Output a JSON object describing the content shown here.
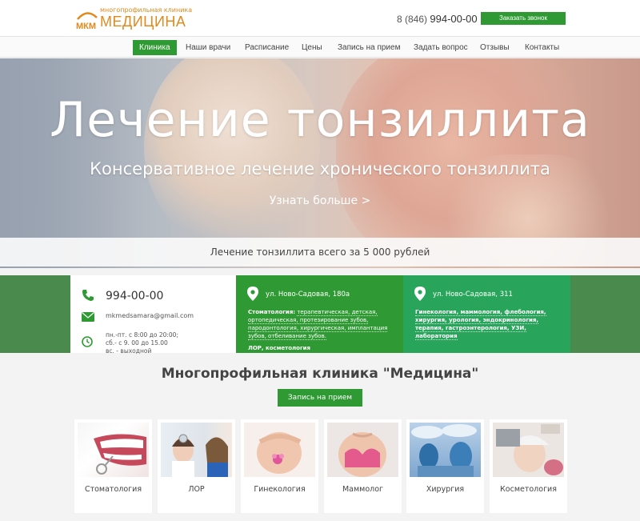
{
  "header": {
    "logo_small": "многопрофильная клиника",
    "logo_big": "МЕДИЦИНА",
    "logo_mark": "МКМ",
    "phone_prefix": "8 (846)",
    "phone_number": "994-00-00",
    "callback_label": "Заказать звонок",
    "accent_color": "#2f9a33",
    "logo_color": "#e08a1e"
  },
  "nav": {
    "items": [
      {
        "label": "Клиника",
        "active": true
      },
      {
        "label": "Наши врачи",
        "active": false
      },
      {
        "label": "Расписание",
        "active": false
      },
      {
        "label": "Цены",
        "active": false
      },
      {
        "label": "Запись на прием",
        "active": false
      },
      {
        "label": "Задать вопрос",
        "active": false
      },
      {
        "label": "Отзывы",
        "active": false
      },
      {
        "label": "Контакты",
        "active": false
      }
    ]
  },
  "hero": {
    "title": "Лечение тонзиллита",
    "subtitle": "Консервативное лечение хронического тонзиллита",
    "more_label": "Узнать больше >",
    "promo": "Лечение тонзиллита всего за 5 000 рублей"
  },
  "contacts": {
    "phone": "994-00-00",
    "email": "mkmedsamara@gmail.com",
    "hours_1": "пн.-пт. с 8:00 до 20:00;",
    "hours_2": "сб.- с 9. 00 до 15.00",
    "hours_3": "вс. - выходной",
    "phone_icon": "phone-icon",
    "mail_icon": "mail-icon",
    "clock_icon": "clock-icon"
  },
  "address1": {
    "title": "ул. Ново-Садовая, 180а",
    "dental_label": "Стоматология:",
    "dental_services": "терапевтическая, детская, ортопедическая, протезирование зубов, пародонтология, хирургическая, имплантация зубов, отбеливание зубов.",
    "extra": "ЛОР, косметология"
  },
  "address2": {
    "title": "ул. Ново-Садовая, 311",
    "services": "Гинекология, маммология, флебология, хирургия, урология, эндокринология, терапия, гастроэнтерология, УЗИ, лаборатория"
  },
  "section": {
    "title": "Многопрофильная клиника \"Медицина\"",
    "appointment_label": "Запись на прием"
  },
  "cards": [
    {
      "label": "Стоматология"
    },
    {
      "label": "ЛОР"
    },
    {
      "label": "Гинекология"
    },
    {
      "label": "Маммолог"
    },
    {
      "label": "Хирургия"
    },
    {
      "label": "Косметология"
    }
  ]
}
